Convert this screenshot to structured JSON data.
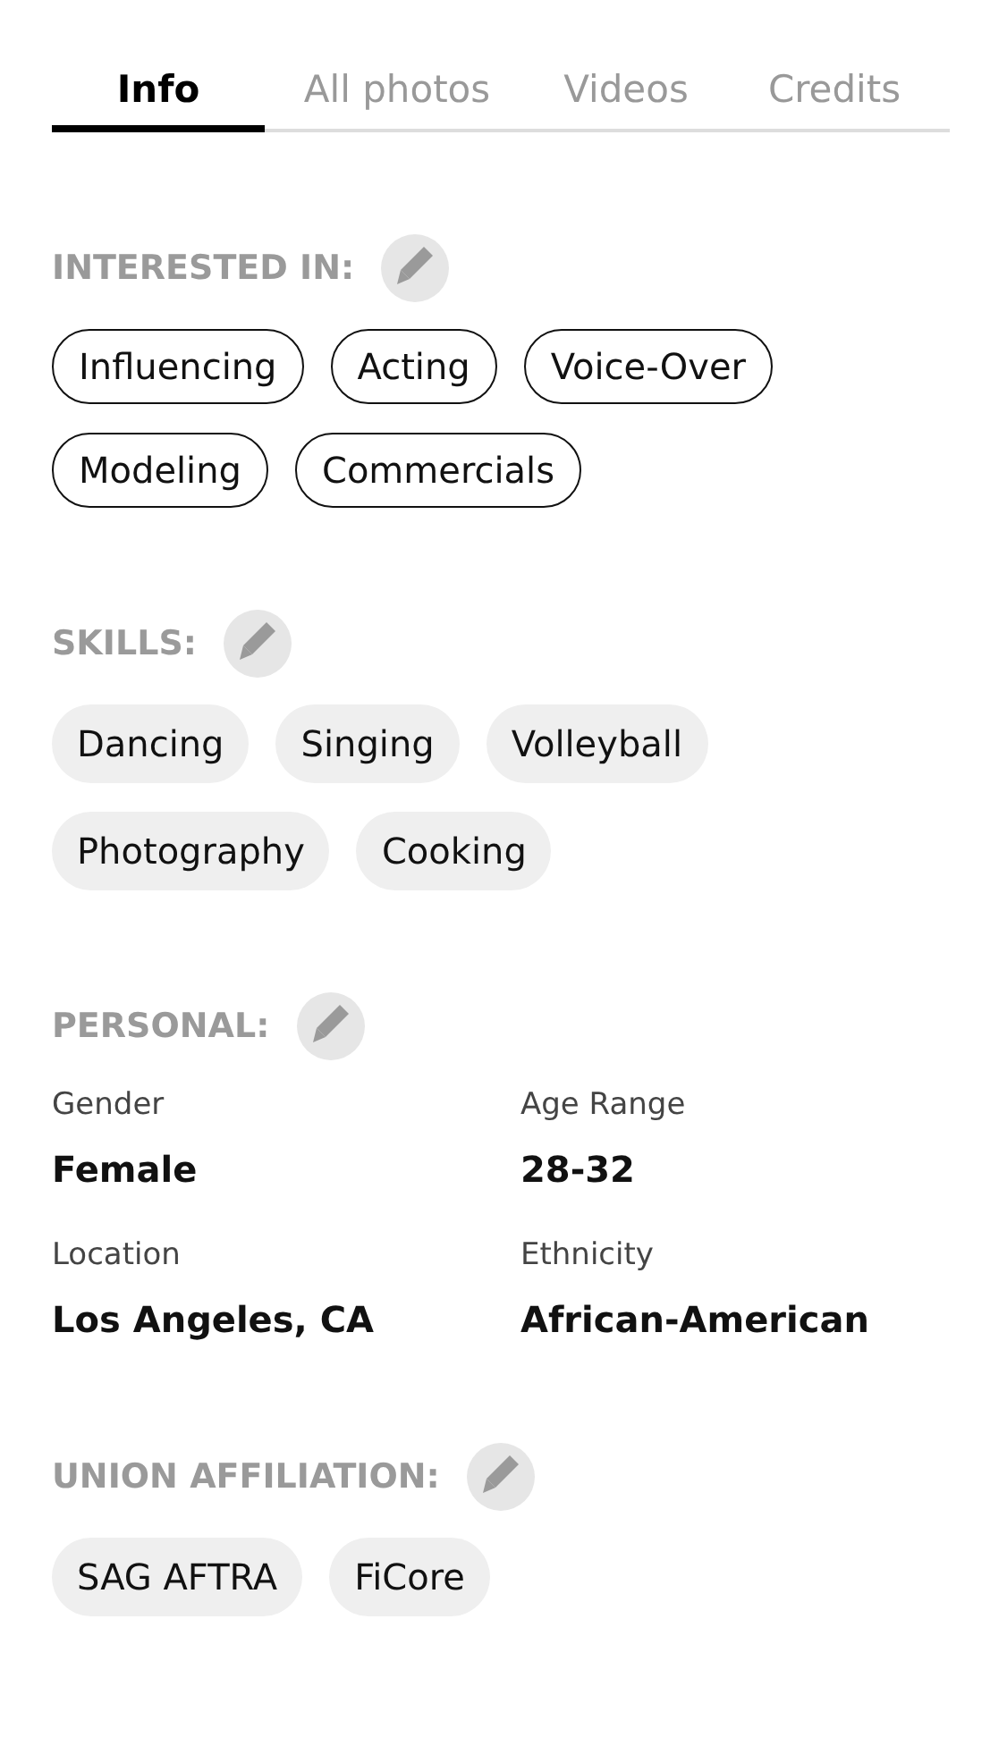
{
  "tabs": [
    {
      "label": "Info",
      "selected": true
    },
    {
      "label": "All photos",
      "selected": false
    },
    {
      "label": "Videos",
      "selected": false
    },
    {
      "label": "Credits",
      "selected": false
    }
  ],
  "sections": [
    {
      "kind": "outline",
      "title": "INTERESTED IN:",
      "items": [
        "Influencing",
        "Acting",
        "Voice-Over",
        "Modeling",
        "Commercials"
      ]
    },
    {
      "kind": "filled",
      "title": "SKILLS:",
      "items": [
        "Dancing",
        "Singing",
        "Volleyball",
        "Photography",
        "Cooking"
      ]
    },
    {
      "kind": "fields",
      "title": "PERSONAL:",
      "fields": [
        {
          "label": "Gender",
          "value": "Female"
        },
        {
          "label": "Age Range",
          "value": "28-32"
        },
        {
          "label": "Location",
          "value": "Los Angeles, CA"
        },
        {
          "label": "Ethnicity",
          "value": "African-American"
        }
      ]
    },
    {
      "kind": "filled",
      "title": "UNION AFFILIATION:",
      "items": [
        "SAG AFTRA",
        "FiCore"
      ]
    }
  ]
}
